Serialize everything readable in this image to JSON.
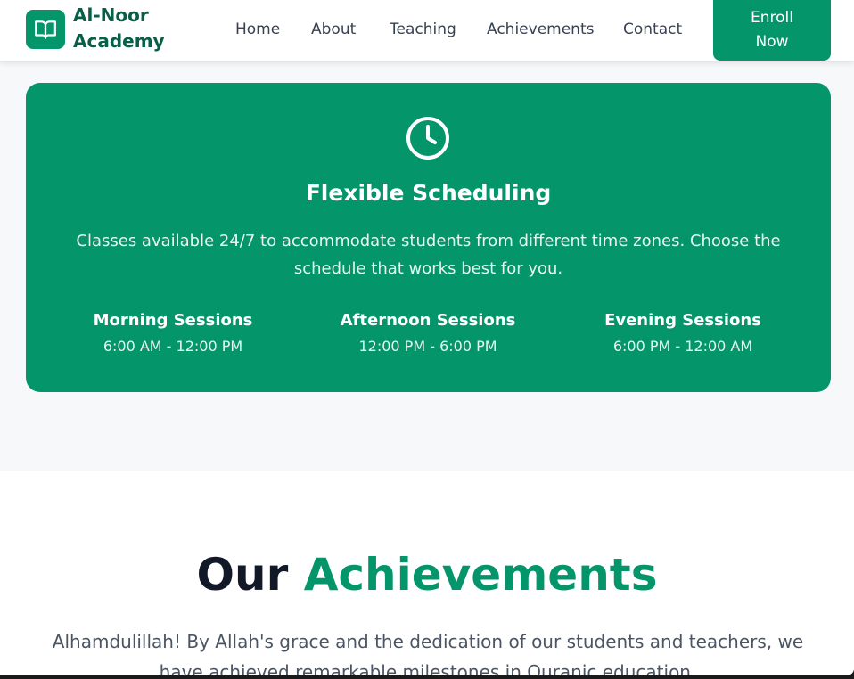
{
  "navbar": {
    "brand_line1": "Al-Noor",
    "brand_line2": "Academy",
    "logo_icon": "book-open-icon",
    "links": [
      "Home",
      "About",
      "Teaching",
      "Achievements",
      "Contact"
    ],
    "enroll_line1": "Enroll",
    "enroll_line2": "Now"
  },
  "schedule": {
    "icon": "clock-icon",
    "title": "Flexible Scheduling",
    "description": "Classes available 24/7 to accommodate students from different time zones. Choose the schedule that works best for you.",
    "sessions": [
      {
        "title": "Morning Sessions",
        "time": "6:00 AM - 12:00 PM"
      },
      {
        "title": "Afternoon Sessions",
        "time": "12:00 PM - 6:00 PM"
      },
      {
        "title": "Evening Sessions",
        "time": "6:00 PM - 12:00 AM"
      }
    ]
  },
  "achievements": {
    "title_part1": "Our",
    "title_part2": "Achievements",
    "description": "Alhamdulillah! By Allah's grace and the dedication of our students and teachers, we have achieved remarkable milestones in Quranic education."
  },
  "colors": {
    "brand_green": "#05956a",
    "brand_dark_green": "#065f46",
    "heading_dark": "#111827",
    "body_text": "#4b5563"
  }
}
